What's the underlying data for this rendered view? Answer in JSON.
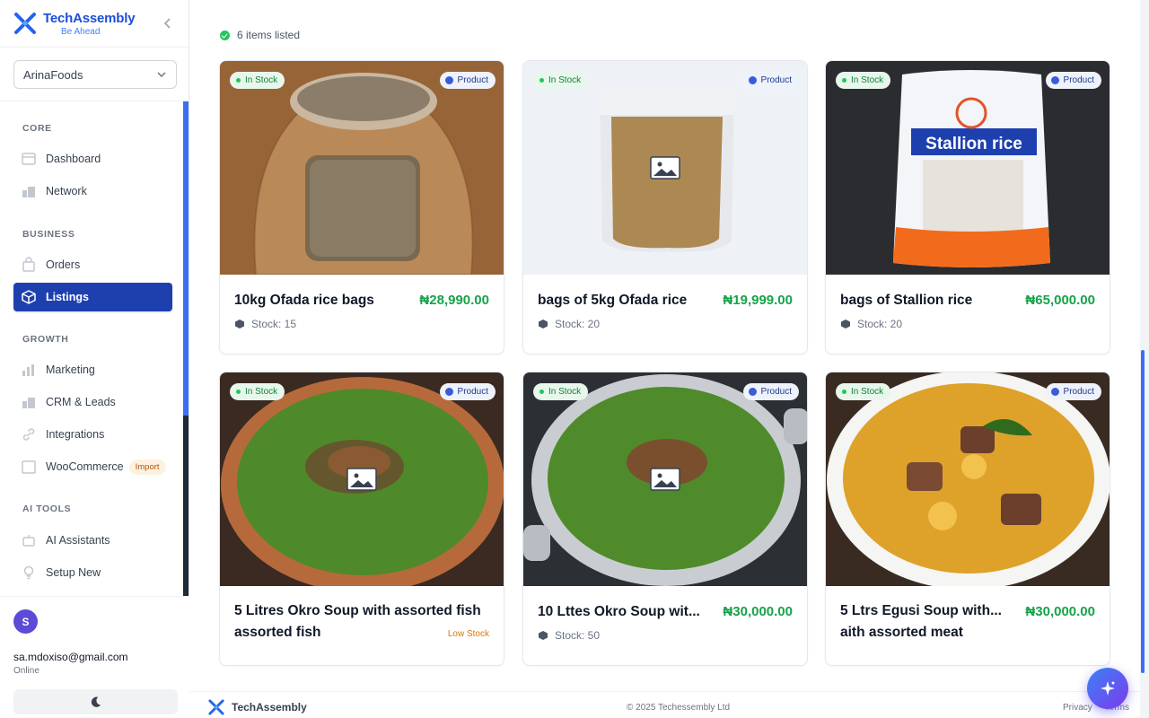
{
  "brand": {
    "name": "TechAssembly",
    "tagline": "Be Ahead"
  },
  "org_select": {
    "value": "ArinaFoods"
  },
  "nav": {
    "sections": [
      {
        "title": "CORE",
        "items": [
          {
            "label": "Dashboard",
            "icon": "dashboard-icon"
          },
          {
            "label": "Network",
            "icon": "network-icon"
          }
        ]
      },
      {
        "title": "BUSINESS",
        "items": [
          {
            "label": "Orders",
            "icon": "orders-icon"
          },
          {
            "label": "Listings",
            "icon": "box-icon",
            "active": true
          }
        ]
      },
      {
        "title": "GROWTH",
        "items": [
          {
            "label": "Marketing",
            "icon": "chart-icon"
          },
          {
            "label": "CRM & Leads",
            "icon": "users-icon"
          },
          {
            "label": "Integrations",
            "icon": "link-icon"
          },
          {
            "label": "WooCommerce",
            "icon": "store-icon",
            "badge": "Import"
          }
        ]
      },
      {
        "title": "AI TOOLS",
        "items": [
          {
            "label": "AI Assistants",
            "icon": "bot-icon"
          },
          {
            "label": "Setup New",
            "icon": "bulb-icon"
          }
        ]
      }
    ]
  },
  "user": {
    "initial": "S",
    "email": "sa.mdoxiso@gmail.com",
    "status": "Online"
  },
  "listing_summary": {
    "count_text": "6 items listed"
  },
  "products": [
    {
      "title": "10kg Ofada rice bags",
      "price": "₦28,990.00",
      "stock_text": "Stock: 15",
      "stock_pill": "In Stock",
      "type_pill": "Product"
    },
    {
      "title": "bags of 5kg Ofada rice",
      "price": "₦19,999.00",
      "stock_text": "Stock: 20",
      "stock_pill": "In Stock",
      "type_pill": "Product"
    },
    {
      "title": "bags of Stallion rice",
      "price": "₦65,000.00",
      "stock_text": "Stock: 20",
      "stock_pill": "In Stock",
      "type_pill": "Product",
      "image_text": "Stallion rice"
    },
    {
      "title": "5 Litres Okro Soup with assorted fish assorted fish",
      "price": "",
      "stock_text": "",
      "low_stock": "Low Stock",
      "stock_pill": "In Stock",
      "type_pill": "Product"
    },
    {
      "title": "10 Lttes Okro Soup wit...",
      "price": "₦30,000.00",
      "stock_text": "Stock: 50",
      "stock_pill": "In Stock",
      "type_pill": "Product"
    },
    {
      "title": "5 Ltrs Egusi Soup with... aith assorted meat",
      "price": "₦30,000.00",
      "stock_text": "",
      "stock_pill": "In Stock",
      "type_pill": "Product"
    }
  ],
  "footer": {
    "brand": "TechAssembly",
    "copyright": "© 2025 Techessembly Ltd",
    "links": [
      "Privacy",
      "Terms"
    ]
  },
  "colors": {
    "accent": "#1e40af",
    "price": "#16a34a",
    "in_stock": "#22c55e",
    "low_stock": "#d97706"
  }
}
